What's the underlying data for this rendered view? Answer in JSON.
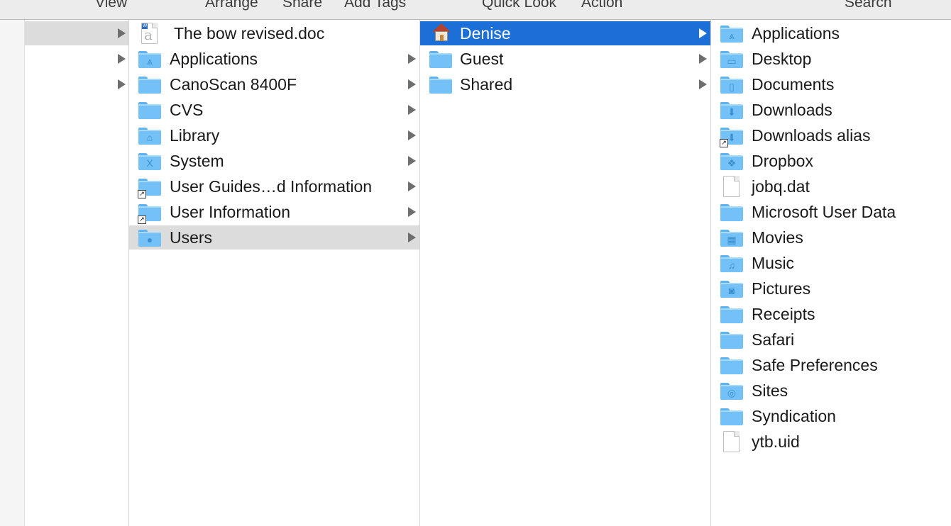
{
  "toolbar": {
    "view": "View",
    "arrange": "Arrange",
    "share": "Share",
    "add_tags": "Add Tags",
    "quick_look": "Quick Look",
    "action": "Action",
    "search": "Search"
  },
  "column1": {
    "items": [
      {
        "label": "The bow revised.doc",
        "icon": "word-doc-icon"
      },
      {
        "label": "Applications",
        "icon": "applications-folder-icon"
      },
      {
        "label": "CanoScan 8400F",
        "icon": "folder-icon"
      },
      {
        "label": "CVS",
        "icon": "folder-icon"
      },
      {
        "label": "Library",
        "icon": "library-folder-icon"
      },
      {
        "label": "System",
        "icon": "system-folder-icon"
      },
      {
        "label": "User Guides…d Information",
        "icon": "folder-alias-icon"
      },
      {
        "label": "User Information",
        "icon": "folder-alias-icon"
      },
      {
        "label": "Users",
        "icon": "users-folder-icon"
      }
    ]
  },
  "column2": {
    "items": [
      {
        "label": "Denise",
        "icon": "home-icon"
      },
      {
        "label": "Guest",
        "icon": "folder-icon"
      },
      {
        "label": "Shared",
        "icon": "folder-icon"
      }
    ]
  },
  "column3": {
    "items": [
      {
        "label": "Applications",
        "icon": "applications-folder-icon"
      },
      {
        "label": "Desktop",
        "icon": "desktop-folder-icon"
      },
      {
        "label": "Documents",
        "icon": "documents-folder-icon"
      },
      {
        "label": "Downloads",
        "icon": "downloads-folder-icon"
      },
      {
        "label": "Downloads alias",
        "icon": "downloads-alias-icon"
      },
      {
        "label": "Dropbox",
        "icon": "dropbox-folder-icon"
      },
      {
        "label": "jobq.dat",
        "icon": "file-icon"
      },
      {
        "label": "Microsoft User Data",
        "icon": "folder-icon"
      },
      {
        "label": "Movies",
        "icon": "movies-folder-icon"
      },
      {
        "label": "Music",
        "icon": "music-folder-icon"
      },
      {
        "label": "Pictures",
        "icon": "pictures-folder-icon"
      },
      {
        "label": "Receipts",
        "icon": "folder-icon"
      },
      {
        "label": "Safari",
        "icon": "folder-icon"
      },
      {
        "label": "Safe Preferences",
        "icon": "folder-icon"
      },
      {
        "label": "Sites",
        "icon": "sites-folder-icon"
      },
      {
        "label": "Syndication",
        "icon": "folder-icon"
      },
      {
        "label": "ytb.uid",
        "icon": "file-icon"
      }
    ]
  },
  "colors": {
    "selection_blue": "#1c6fd6",
    "selection_gray": "#dcdcdc",
    "folder_blue": "#73c1f6"
  }
}
